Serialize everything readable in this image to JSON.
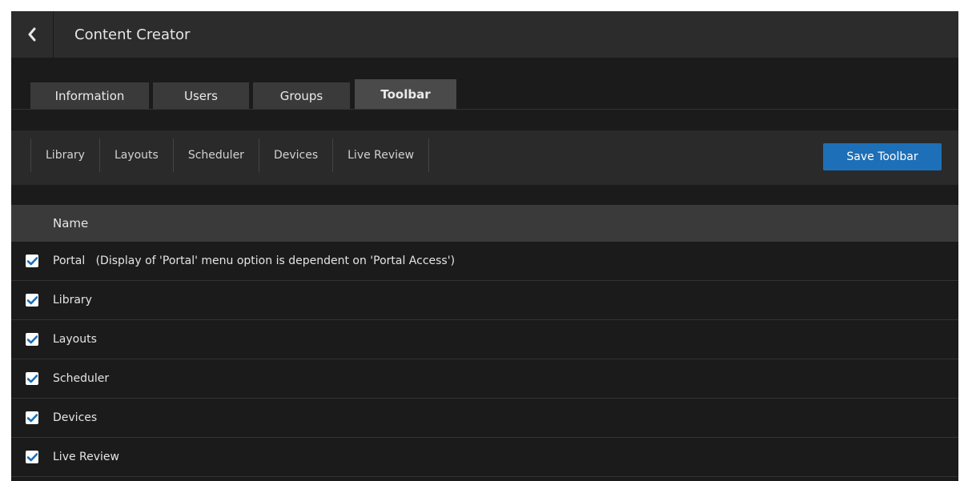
{
  "header": {
    "title": "Content Creator",
    "back_icon": "chevron-left-icon"
  },
  "tabs": [
    {
      "label": "Information",
      "active": false
    },
    {
      "label": "Users",
      "active": false
    },
    {
      "label": "Groups",
      "active": false
    },
    {
      "label": "Toolbar",
      "active": true
    }
  ],
  "toolbar": {
    "items": [
      "Library",
      "Layouts",
      "Scheduler",
      "Devices",
      "Live Review"
    ],
    "save_label": "Save Toolbar"
  },
  "table": {
    "column_name": "Name",
    "rows": [
      {
        "label": "Portal   (Display of 'Portal' menu option is dependent on 'Portal Access')",
        "checked": true
      },
      {
        "label": "Library",
        "checked": true
      },
      {
        "label": "Layouts",
        "checked": true
      },
      {
        "label": "Scheduler",
        "checked": true
      },
      {
        "label": "Devices",
        "checked": true
      },
      {
        "label": "Live Review",
        "checked": true
      }
    ]
  },
  "colors": {
    "background": "#1b1b1b",
    "header": "#2c2c2c",
    "accent": "#1d6fb8",
    "checkbox_check": "#1d6fb8"
  }
}
